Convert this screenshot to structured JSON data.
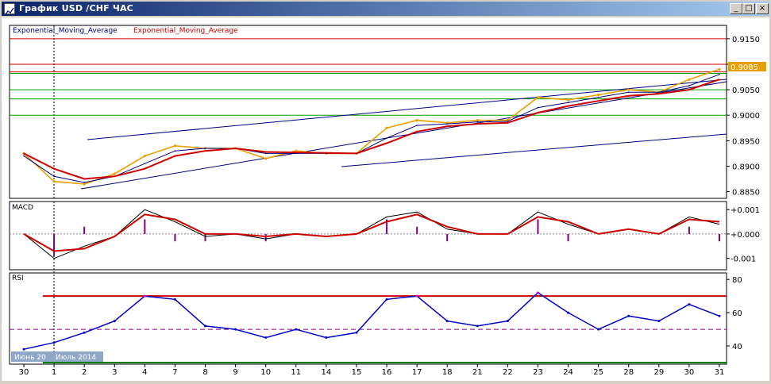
{
  "window": {
    "title": "График USD /CHF ЧАС",
    "minimize_glyph": "_",
    "maximize_glyph": "□",
    "close_glyph": "×"
  },
  "colors": {
    "price": "#e8a000",
    "ema_fast": "#000080",
    "ema_slow": "#cc0000",
    "hline_red": "#cc0000",
    "hline_green": "#00a000",
    "trend": "#000080",
    "macd_line": "#000000",
    "macd_signal": "#cc0000",
    "macd_hist": "#800080",
    "rsi_line": "#0000c8",
    "rsi_over": "#e000e0",
    "rsi_level_hi": "#cc0000",
    "rsi_level_mid": "#800080",
    "rsi_level_lo": "#008000",
    "current_price_bg": "#e8a000"
  },
  "panes": {
    "price": {
      "legend_ema1": "Exponential_Moving_Average",
      "legend_ema2": "Exponential_Moving_Average",
      "current_price": "0.9085",
      "yticks": [
        "0.9150",
        "0.9100",
        "0.9050",
        "0.9000",
        "0.8950",
        "0.8900",
        "0.8850"
      ]
    },
    "macd": {
      "label": "MACD",
      "yticks": [
        "+0.001",
        "+0.000",
        "-0.001"
      ]
    },
    "rsi": {
      "label": "RSI",
      "yticks": [
        "80",
        "60",
        "40"
      ]
    }
  },
  "xaxis": {
    "ticks": [
      "30",
      "1",
      "2",
      "3",
      "4",
      "7",
      "8",
      "9",
      "10",
      "11",
      "14",
      "15",
      "16",
      "17",
      "18",
      "21",
      "22",
      "23",
      "24",
      "25",
      "28",
      "29",
      "30",
      "31"
    ],
    "month_label": "Июль 2014",
    "month_label_prev": "Июнь 20"
  },
  "chart_data": {
    "type": "line",
    "x": [
      "30",
      "1",
      "2",
      "3",
      "4",
      "7",
      "8",
      "9",
      "10",
      "11",
      "14",
      "15",
      "16",
      "17",
      "18",
      "21",
      "22",
      "23",
      "24",
      "25",
      "28",
      "29",
      "30",
      "31"
    ],
    "series": [
      {
        "values": [
          0.8925,
          0.887,
          0.8865,
          0.8885,
          0.892,
          0.894,
          0.8935,
          0.8935,
          0.8915,
          0.893,
          0.8925,
          0.8925,
          0.8975,
          0.899,
          0.8985,
          0.899,
          0.899,
          0.9035,
          0.903,
          0.904,
          0.905,
          0.9045,
          0.907,
          0.909
        ]
      },
      {
        "values": [
          0.892,
          0.888,
          0.8868,
          0.888,
          0.8905,
          0.893,
          0.8935,
          0.8935,
          0.8925,
          0.8925,
          0.8925,
          0.8925,
          0.8955,
          0.898,
          0.8983,
          0.8987,
          0.8988,
          0.9015,
          0.9025,
          0.9035,
          0.9045,
          0.9045,
          0.9058,
          0.908
        ]
      },
      {
        "values": [
          0.8925,
          0.8895,
          0.8875,
          0.888,
          0.8895,
          0.892,
          0.893,
          0.8935,
          0.8928,
          0.8927,
          0.8926,
          0.8925,
          0.8945,
          0.8968,
          0.8978,
          0.8983,
          0.8985,
          0.9005,
          0.9018,
          0.9028,
          0.9038,
          0.9042,
          0.905,
          0.907
        ]
      }
    ],
    "ylim": [
      0.884,
      0.917
    ],
    "hlines_red": [
      0.915,
      0.91,
      0.9085
    ],
    "hlines_green": [
      0.9082,
      0.905,
      0.9032,
      0.9
    ],
    "macd": {
      "ylim": [
        -0.0014,
        0.0012
      ],
      "series": [
        {
          "values": [
            0.0,
            -0.001,
            -0.0005,
            -0.0001,
            0.001,
            0.0005,
            -0.0001,
            0.0,
            -0.0002,
            0.0,
            -0.0001,
            0.0,
            0.0007,
            0.0009,
            0.0002,
            0.0,
            0.0,
            0.0009,
            0.0004,
            0.0,
            0.0002,
            0.0,
            0.0007,
            0.0004
          ]
        },
        {
          "values": [
            0.0,
            -0.0007,
            -0.0006,
            -0.0001,
            0.0008,
            0.0006,
            0.0,
            0.0,
            -0.0001,
            0.0,
            -0.0001,
            0.0,
            0.0005,
            0.0008,
            0.0003,
            0.0,
            0.0,
            0.0007,
            0.0005,
            0.0,
            0.0002,
            0.0,
            0.0006,
            0.0005
          ]
        }
      ]
    },
    "rsi": {
      "ylim": [
        30,
        82
      ],
      "levels": [
        70,
        50,
        30
      ],
      "values": [
        38,
        42,
        48,
        55,
        70,
        68,
        52,
        50,
        45,
        50,
        45,
        48,
        68,
        70,
        55,
        52,
        55,
        72,
        60,
        50,
        58,
        55,
        65,
        58
      ]
    }
  }
}
